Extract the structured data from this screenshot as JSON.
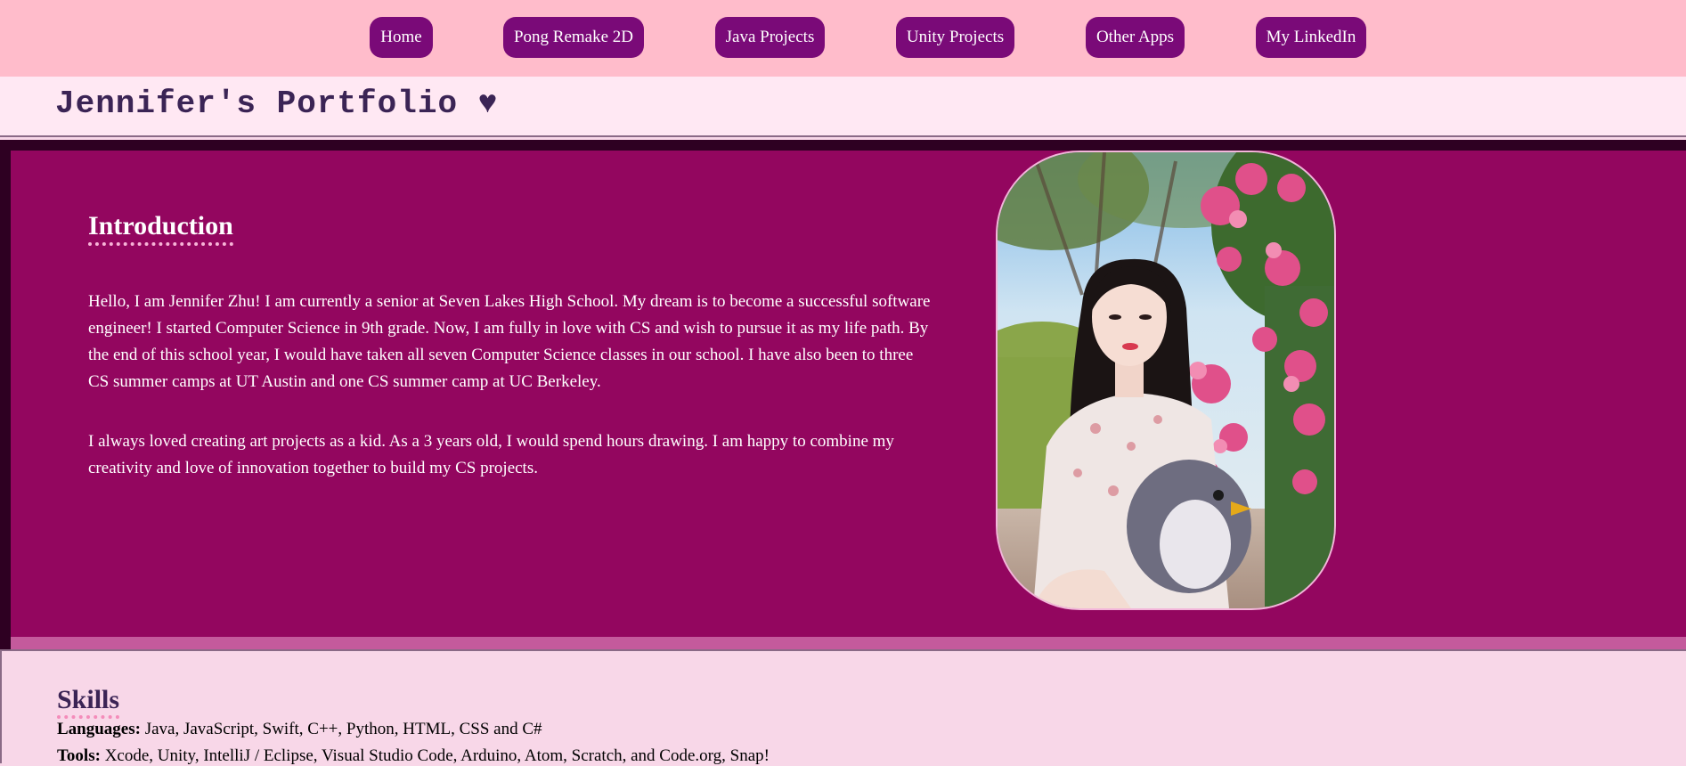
{
  "nav": {
    "items": [
      {
        "label": "Home"
      },
      {
        "label": "Pong Remake 2D"
      },
      {
        "label": "Java Projects"
      },
      {
        "label": "Unity Projects"
      },
      {
        "label": "Other Apps"
      },
      {
        "label": "My LinkedIn"
      }
    ]
  },
  "header": {
    "title": "Jennifer's Portfolio ♥"
  },
  "intro": {
    "heading": "Introduction",
    "paragraphs": [
      "Hello, I am Jennifer Zhu! I am currently a senior at Seven Lakes High School. My dream is to become a successful software engineer! I started Computer Science in 9th grade. Now, I am fully in love with CS and wish to pursue it as my life path. By the end of this school year, I would have taken all seven Computer Science classes in our school. I have also been to three CS summer camps at UT Austin and one CS summer camp at UC Berkeley.",
      "I always loved creating art projects as a kid. As a 3 years old, I would spend hours drawing. I am happy to combine my creativity and love of innovation together to build my CS projects."
    ]
  },
  "skills": {
    "heading": "Skills",
    "rows": [
      {
        "label": "Languages:",
        "value": "Java, JavaScript, Swift, C++, Python, HTML, CSS and C#"
      },
      {
        "label": "Tools:",
        "value": "Xcode, Unity, IntelliJ / Eclipse, Visual Studio Code, Arduino, Atom, Scratch, and Code.org, Snap!"
      }
    ]
  },
  "colors": {
    "nav_background": "#ffbccb",
    "nav_button": "#7a0a78",
    "intro_background": "#93065f",
    "title_text": "#3b2455",
    "page_background": "#f8d7e8"
  }
}
